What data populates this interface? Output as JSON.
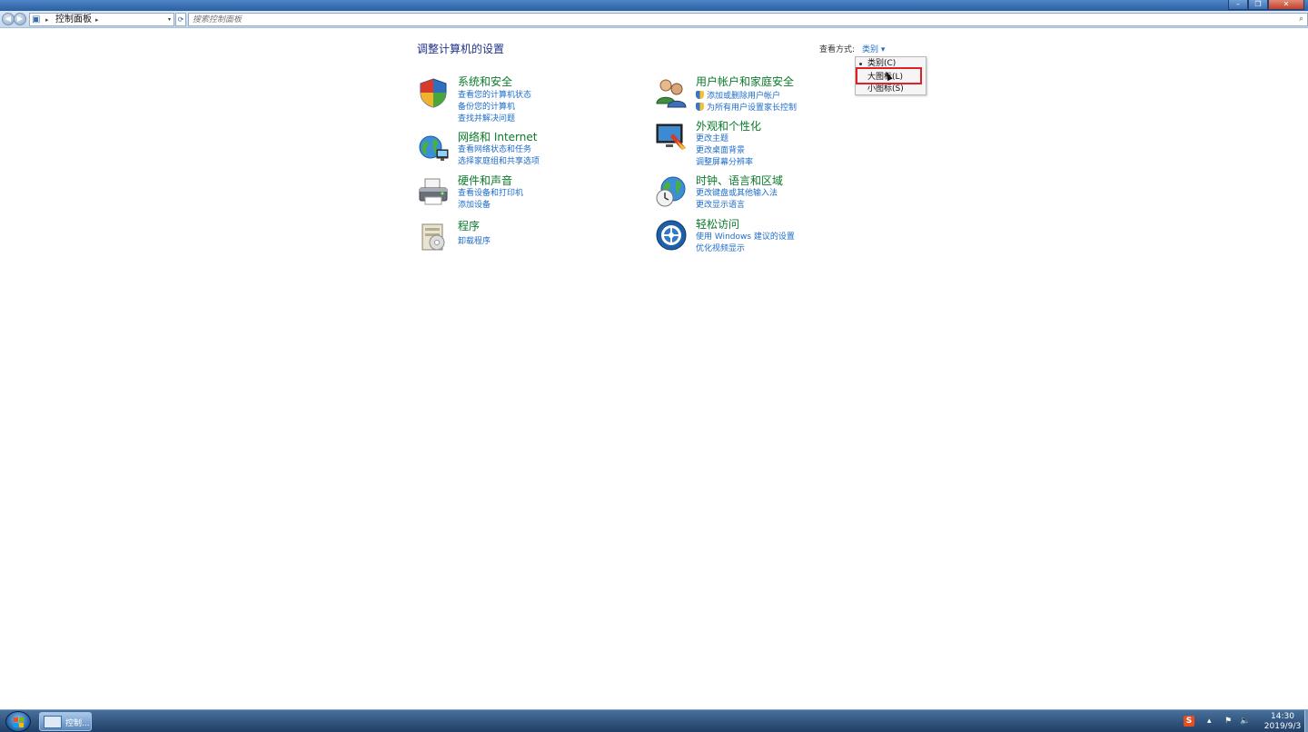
{
  "window": {
    "controls": {
      "minimize": "–",
      "maximize": "❐",
      "close": "✕"
    }
  },
  "addressbar": {
    "crumb": "控制面板",
    "search_placeholder": "搜索控制面板"
  },
  "content": {
    "title": "调整计算机的设置",
    "viewby_label": "查看方式:",
    "viewby_value": "类别 ▾"
  },
  "dropdown": {
    "items": [
      "类别(C)",
      "大图标(L)",
      "小图标(S)"
    ],
    "selected_index": 0,
    "highlighted_index": 1
  },
  "categories": [
    {
      "title": "系统和安全",
      "links": [
        "查看您的计算机状态",
        "备份您的计算机",
        "查找并解决问题"
      ],
      "icon": "shield-icon"
    },
    {
      "title": "网络和 Internet",
      "links": [
        "查看网络状态和任务",
        "选择家庭组和共享选项"
      ],
      "icon": "network-globe-icon"
    },
    {
      "title": "硬件和声音",
      "links": [
        "查看设备和打印机",
        "添加设备"
      ],
      "icon": "printer-icon"
    },
    {
      "title": "程序",
      "links": [
        "卸载程序"
      ],
      "icon": "programs-icon"
    },
    {
      "title": "用户帐户和家庭安全",
      "links": [
        "添加或删除用户帐户",
        "为所有用户设置家长控制"
      ],
      "icon": "users-icon"
    },
    {
      "title": "外观和个性化",
      "links": [
        "更改主题",
        "更改桌面背景",
        "调整屏幕分辨率"
      ],
      "icon": "monitor-icon"
    },
    {
      "title": "时钟、语言和区域",
      "links": [
        "更改键盘或其他输入法",
        "更改显示语言"
      ],
      "icon": "globe-clock-icon"
    },
    {
      "title": "轻松访问",
      "links": [
        "使用 Windows 建议的设置",
        "优化视频显示"
      ],
      "icon": "ease-of-access-icon"
    }
  ],
  "taskbar": {
    "task_label": "控制...",
    "time": "14:30",
    "date": "2019/9/3",
    "ime": "S"
  }
}
